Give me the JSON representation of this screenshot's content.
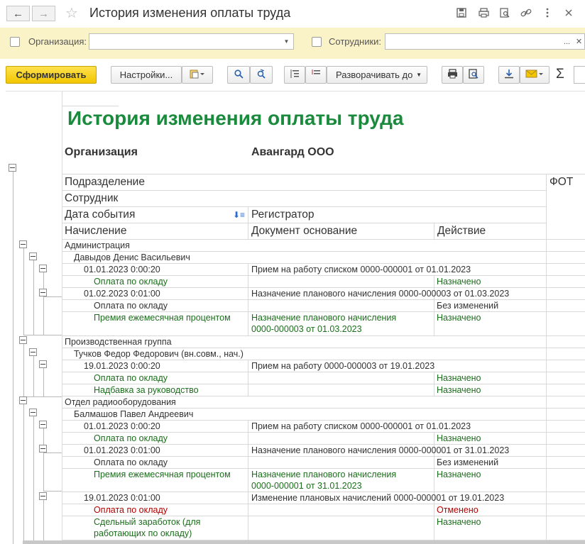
{
  "window": {
    "title": "История изменения оплаты труда",
    "back_icon": "←",
    "forward_icon": "→",
    "favorite_icon": "☆"
  },
  "filters": {
    "organization_label": "Организация:",
    "organization_value": "",
    "employees_label": "Сотрудники:",
    "employees_value": "",
    "employees_more": "..."
  },
  "toolbar": {
    "generate_label": "Сформировать",
    "settings_label": "Настройки...",
    "expand_label": "Разворачивать до",
    "sigma": "Σ"
  },
  "report": {
    "title": "История изменения оплаты труда",
    "org_label": "Организация",
    "org_value": "Авангард ООО",
    "headers": {
      "department": "Подразделение",
      "employee": "Сотрудник",
      "event_date": "Дата события",
      "registrar": "Регистратор",
      "accrual": "Начисление",
      "base_document": "Документ основание",
      "action": "Действие",
      "fot": "ФОТ"
    },
    "rows": [
      {
        "a": "Администрация"
      },
      {
        "a": "Давыдов Денис Васильевич"
      },
      {
        "a": "01.01.2023 0:00:20",
        "b": "Прием на работу списком 0000-000001 от 01.01.2023"
      },
      {
        "a": "Оплата по окладу",
        "c": "Назначено"
      },
      {
        "a": "01.02.2023 0:01:00",
        "b": "Назначение планового начисления 0000-000003 от 01.03.2023"
      },
      {
        "a": "Оплата по окладу",
        "c": "Без изменений"
      },
      {
        "a": "Премия ежемесячная процентом",
        "b1": "Назначение планового начисления",
        "b2": "0000-000003 от 01.03.2023",
        "c": "Назначено"
      },
      {
        "a": "Производственная группа"
      },
      {
        "a": "Тучков Федор Федорович (вн.совм., нач.)"
      },
      {
        "a": "19.01.2023 0:00:20",
        "b": "Прием на работу 0000-000003 от 19.01.2023"
      },
      {
        "a": "Оплата по окладу",
        "c": "Назначено"
      },
      {
        "a": "Надбавка за руководство",
        "c": "Назначено"
      },
      {
        "a": "Отдел радиооборудования"
      },
      {
        "a": "Балмашов Павел Андреевич"
      },
      {
        "a": "01.01.2023 0:00:20",
        "b": "Прием на работу списком 0000-000001 от 01.01.2023"
      },
      {
        "a": "Оплата по окладу",
        "c": "Назначено"
      },
      {
        "a": "01.01.2023 0:01:00",
        "b": "Назначение планового начисления 0000-000001 от 31.01.2023"
      },
      {
        "a": "Оплата по окладу",
        "c": "Без изменений"
      },
      {
        "a": "Премия ежемесячная процентом",
        "b1": "Назначение планового начисления",
        "b2": "0000-000001 от 31.01.2023",
        "c": "Назначено"
      },
      {
        "a": "19.01.2023 0:01:00",
        "b": "Изменение плановых начислений 0000-000001 от 19.01.2023"
      },
      {
        "a": "Оплата по окладу",
        "c": "Отменено"
      },
      {
        "a1": "Сдельный заработок (для",
        "a2": "работающих по окладу)",
        "c": "Назначено"
      }
    ]
  },
  "colors": {
    "title_green": "#1a8a3c",
    "accrual_green": "#1b6e1b",
    "cancelled_red": "#b30000",
    "filter_bg": "#fbf3c8",
    "primary_button": "#f2c600"
  }
}
